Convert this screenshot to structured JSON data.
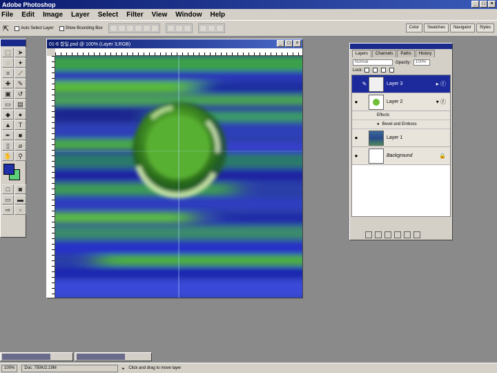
{
  "app": {
    "title": "Adobe Photoshop"
  },
  "menu": [
    "File",
    "Edit",
    "Image",
    "Layer",
    "Select",
    "Filter",
    "View",
    "Window",
    "Help"
  ],
  "options_bar": {
    "auto_select_label": "Auto Select Layer",
    "bounding_box_label": "Show Bounding Box",
    "palette_tabs": [
      "Color",
      "Swatches",
      "Navigator",
      "Styles"
    ]
  },
  "document": {
    "title": "01-6 할일.psd @ 100% (Layer 3,RGB)"
  },
  "layers_panel": {
    "tabs": [
      "Layers",
      "Channels",
      "Paths",
      "History"
    ],
    "blend_mode": "Normal",
    "opacity_label": "Opacity:",
    "opacity_value": "100%",
    "lock_label": "Lock:",
    "layers": [
      {
        "name": "Layer 3",
        "selected": true,
        "thumb_color": "#f0f0f0"
      },
      {
        "name": "Layer 2",
        "selected": false,
        "thumb_color": "#6fbf3a"
      },
      {
        "name": "Layer 1",
        "selected": false,
        "thumb_color": "#3a5a8a"
      },
      {
        "name": "Background",
        "selected": false,
        "thumb_color": "#ffffff"
      }
    ],
    "effects_label": "Effects",
    "bevel_label": "Bevel and Emboss"
  },
  "status": {
    "zoom": "100%",
    "doc_info": "Doc: 750K/2.19M",
    "hint": "Click and drag to move layer"
  },
  "colors": {
    "foreground": "#2030a8",
    "background": "#5ed07a",
    "title_bar": "#0a1a6e"
  }
}
